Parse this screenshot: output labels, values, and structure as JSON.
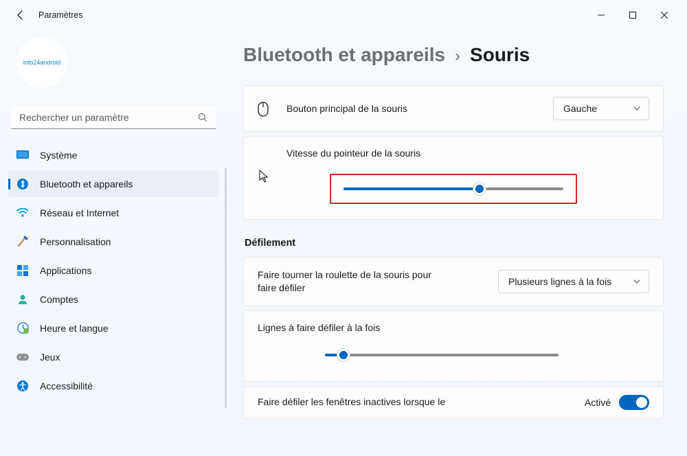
{
  "titlebar": {
    "app_title": "Paramètres"
  },
  "avatar_text": "info24android",
  "search": {
    "placeholder": "Rechercher un paramètre"
  },
  "nav": [
    {
      "label": "Système"
    },
    {
      "label": "Bluetooth et appareils"
    },
    {
      "label": "Réseau et Internet"
    },
    {
      "label": "Personnalisation"
    },
    {
      "label": "Applications"
    },
    {
      "label": "Comptes"
    },
    {
      "label": "Heure et langue"
    },
    {
      "label": "Jeux"
    },
    {
      "label": "Accessibilité"
    }
  ],
  "breadcrumb": {
    "parent": "Bluetooth et appareils",
    "sep": "›",
    "current": "Souris"
  },
  "primary_button": {
    "label": "Bouton principal de la souris",
    "value": "Gauche"
  },
  "pointer_speed": {
    "label": "Vitesse du pointeur de la souris",
    "value_percent": 62
  },
  "scroll_section": {
    "title": "Défilement",
    "wheel": {
      "label": "Faire tourner la roulette de la souris pour faire défiler",
      "value": "Plusieurs lignes à la fois"
    },
    "lines": {
      "label": "Lignes à faire défiler à la fois",
      "value_percent": 8
    },
    "inactive": {
      "label": "Faire défiler les fenêtres inactives lorsque le",
      "value_text": "Activé"
    }
  }
}
